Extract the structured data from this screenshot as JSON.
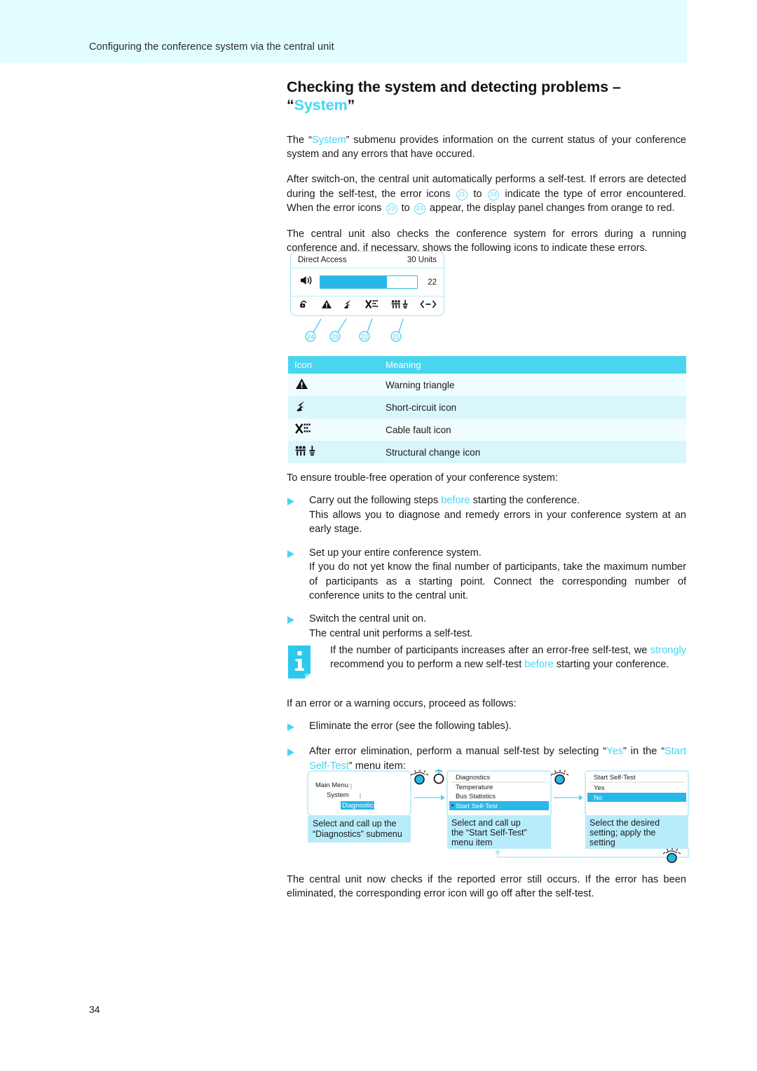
{
  "header": {
    "running_title": "Configuring the conference system via the central unit"
  },
  "title": {
    "part1": "Checking the system and detecting problems – “",
    "accent": "System",
    "part2": "”"
  },
  "paragraphs": {
    "p1_a": "The “",
    "p1_accent": "System",
    "p1_b": "” submenu provides information on the current status of your conference system and any errors that have occured.",
    "p2_a": "After switch-on, the central unit automatically performs a self-test. If errors are detected during the self-test, the error icons ",
    "p2_n1": "21",
    "p2_b": " to ",
    "p2_n2": "24",
    "p2_c": " indicate the type of error encountered. When the error icons ",
    "p2_n3": "23",
    "p2_d": " to ",
    "p2_n4": "24",
    "p2_e": " appear, the display panel changes from orange to red.",
    "p3": "The central unit also checks the conference system for errors during a running conference and, if necessary, shows the following icons to indicate these errors.",
    "p4": "To ensure trouble-free operation of your conference system:",
    "p5": "If an error or a warning occurs, proceed as follows:",
    "p6": "The central unit now checks if the reported error still occurs. If the error has been eliminated, the corresponding error icon will go off after the self-test."
  },
  "display_panel": {
    "title": "Direct Access",
    "units": "30 Units",
    "volume_value": "22",
    "volume_percent": 69,
    "speaker_icon": "speaker-icon",
    "status_icons": [
      "unlocked-icon",
      "warning-triangle-icon",
      "short-circuit-icon",
      "cable-fault-icon",
      "structural-change-icon",
      "link-icon"
    ],
    "callouts": [
      "24",
      "23",
      "22",
      "21"
    ]
  },
  "icon_table": {
    "headers": [
      "Icon",
      "Meaning"
    ],
    "rows": [
      {
        "icon": "warning-triangle-icon",
        "meaning": "Warning triangle"
      },
      {
        "icon": "short-circuit-icon",
        "meaning": "Short-circuit icon"
      },
      {
        "icon": "cable-fault-icon",
        "meaning": "Cable fault icon"
      },
      {
        "icon": "structural-change-icon",
        "meaning": "Structural change icon"
      }
    ]
  },
  "bullets_setup": [
    {
      "line1_a": "Carry out the following steps ",
      "line1_accent": "before",
      "line1_b": " starting the conference.",
      "body": "This allows you to diagnose and remedy errors in your conference system at an early stage."
    },
    {
      "line1_a": "Set up your entire conference system.",
      "line1_accent": "",
      "line1_b": "",
      "body": "If you do not yet know the final number of participants, take the maximum number of participants as a starting point. Connect the corresponding number of conference units to the central unit."
    },
    {
      "line1_a": "Switch the central unit on.",
      "line1_accent": "",
      "line1_b": "",
      "body": "The central unit performs a self-test."
    }
  ],
  "note": {
    "icon": "info-icon",
    "a": "If the number of participants increases after an error-free self-test, we ",
    "accent1": "strongly",
    "b": " recommend you to perform a new self-test ",
    "accent2": "before",
    "c": " starting your conference."
  },
  "bullets_error": [
    {
      "a": "Eliminate the error (see the following tables).",
      "accent1": "",
      "b": "",
      "accent2": "",
      "c": ""
    },
    {
      "a": "After error elimination, perform a manual self-test by selecting “",
      "accent1": "Yes",
      "b": "” in the “",
      "accent2": "Start Self-Test",
      "c": "” menu item:"
    }
  ],
  "workflow": {
    "steps": [
      {
        "screen_lines": [
          "Main Menu",
          "System",
          "Diagnostics"
        ],
        "highlighted": "Diagnostics",
        "caption": [
          "Select and call up the",
          "“Diagnostics” submenu"
        ]
      },
      {
        "screen_lines": [
          "Diagnostics",
          "Temperature",
          "Bus Statistics",
          "Start Self-Test"
        ],
        "highlighted": "Start Self-Test",
        "caption": [
          "Select and call up",
          "the “Start Self-Test”",
          "menu item"
        ]
      },
      {
        "screen_lines": [
          "Start Self-Test",
          "Yes",
          "No"
        ],
        "highlighted": "No",
        "caption": [
          "Select the desired",
          "setting; apply the",
          "setting"
        ]
      }
    ],
    "knob_icons": [
      "rotate-knob-icon",
      "press-knob-icon",
      "rotate-knob-icon",
      "rotate-knob-icon"
    ]
  },
  "page_number": "34",
  "colors": {
    "accent": "#40d9f5",
    "header_band": "#e2fdff",
    "table_header": "#4ad5ef",
    "row_light": "#f0fdff",
    "row_dark": "#d9f7fb",
    "highlight": "#29b6e8"
  }
}
